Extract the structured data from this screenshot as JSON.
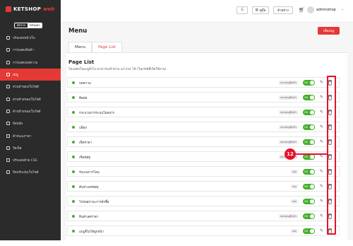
{
  "brand": {
    "name": "KETSHOP",
    "suffix": "web"
  },
  "language": {
    "options": [
      "อัตราย",
      "ปรับแต่ง"
    ],
    "active": 1
  },
  "sidebar": {
    "items": [
      {
        "label": "ปรับแต่งหน้าเว็บ",
        "icon": "layout-icon"
      },
      {
        "label": "การแสดงสินค้า",
        "icon": "grid-icon"
      },
      {
        "label": "การแสดงบทความ",
        "icon": "document-icon"
      },
      {
        "label": "เมนู",
        "icon": "menu-icon",
        "active": true
      },
      {
        "label": "ส่วนหัวของเว็บไซต์",
        "icon": "header-icon"
      },
      {
        "label": "ส่วนท้ายของเว็บไซต์",
        "icon": "footer-icon"
      },
      {
        "label": "ด้านข้างของเว็บไซต์",
        "icon": "sidebar-icon"
      },
      {
        "label": "ป๊อปอัพ",
        "icon": "popup-icon"
      },
      {
        "label": "ค้าหนงเภาษา",
        "icon": "megaphone-icon"
      },
      {
        "label": "วิดเจ็ต",
        "icon": "widget-icon"
      },
      {
        "label": "ปรับแต่งด้วย CSS",
        "icon": "code-icon"
      },
      {
        "label": "ปิดปรับปรุงเว็บไซต์",
        "icon": "maintenance-icon"
      }
    ]
  },
  "topbar": {
    "menu_button": "☰",
    "guide_button": "คู่มือ",
    "preview_button": "ตัวอย่าง",
    "username": "adminshop"
  },
  "page": {
    "title": "Menu",
    "add_button": "เพิ่มเมนู",
    "tabs": [
      {
        "label": "Menu",
        "active": false
      },
      {
        "label": "Page List",
        "active": true
      }
    ],
    "section_title": "Page List",
    "section_subtitle": "ไม่แสดงในเมนูทั่วไป สามารถเข้าผ่าน url link ได้ (ในกรณีที่เปิดใช้งาน)"
  },
  "toggle_label": "ON",
  "rows": [
    {
      "label": "บทความ",
      "badge": "หมวดหมู่สินค้า"
    },
    {
      "label": "ติดต่อ",
      "badge": "หมวดหมู่สินค้า"
    },
    {
      "label": "กระบวนการระบบโดยสาร",
      "badge": "หมวดหมู่สินค้า"
    },
    {
      "label": "บล็อก",
      "badge": "หมวดหมู่สินค้า"
    },
    {
      "label": "เช็คราคา",
      "badge": "หมวดหมู่สินค้า"
    },
    {
      "label": "เช็คพัสดุ",
      "badge": "หมวดหมู่สินค้า"
    },
    {
      "label": "รับแจงการโอน",
      "badge": "เพจ"
    },
    {
      "label": "ค้นหาเลขพัสดุ",
      "badge": "เพจ"
    },
    {
      "label": "โปรดสถานะการสั่งซื้อ",
      "badge": "เพจ"
    },
    {
      "label": "สินค้าลดราคา",
      "badge": "หมวดหมู่สินค้า"
    },
    {
      "label": "เมนูที่ไม่ได้ผูกหน้า",
      "badge": "เพจ"
    }
  ],
  "annotation": {
    "number": "12"
  },
  "colors": {
    "accent": "#e53935",
    "sidebar": "#2b2b2b",
    "toggle_on": "#43b02a",
    "annotation": "#e8112d"
  }
}
